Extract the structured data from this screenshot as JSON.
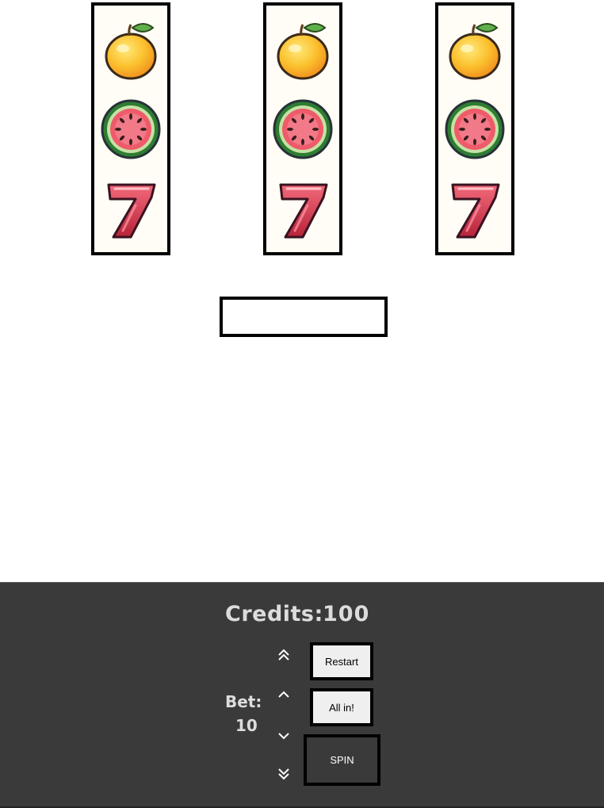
{
  "reels": [
    {
      "symbols": [
        "lemon-icon",
        "watermelon-icon",
        "seven-icon"
      ]
    },
    {
      "symbols": [
        "lemon-icon",
        "watermelon-icon",
        "seven-icon"
      ]
    },
    {
      "symbols": [
        "lemon-icon",
        "watermelon-icon",
        "seven-icon"
      ]
    }
  ],
  "message": "",
  "panel": {
    "credits_label": "Credits:",
    "credits_value": "100",
    "bet_label": "Bet:",
    "bet_value": "10",
    "restart_label": "Restart",
    "allin_label": "All in!",
    "spin_label": "SPIN"
  },
  "colors": {
    "panel_bg": "#3a3a3a",
    "panel_text": "#dcdcdc",
    "button_bg": "#efefef"
  }
}
